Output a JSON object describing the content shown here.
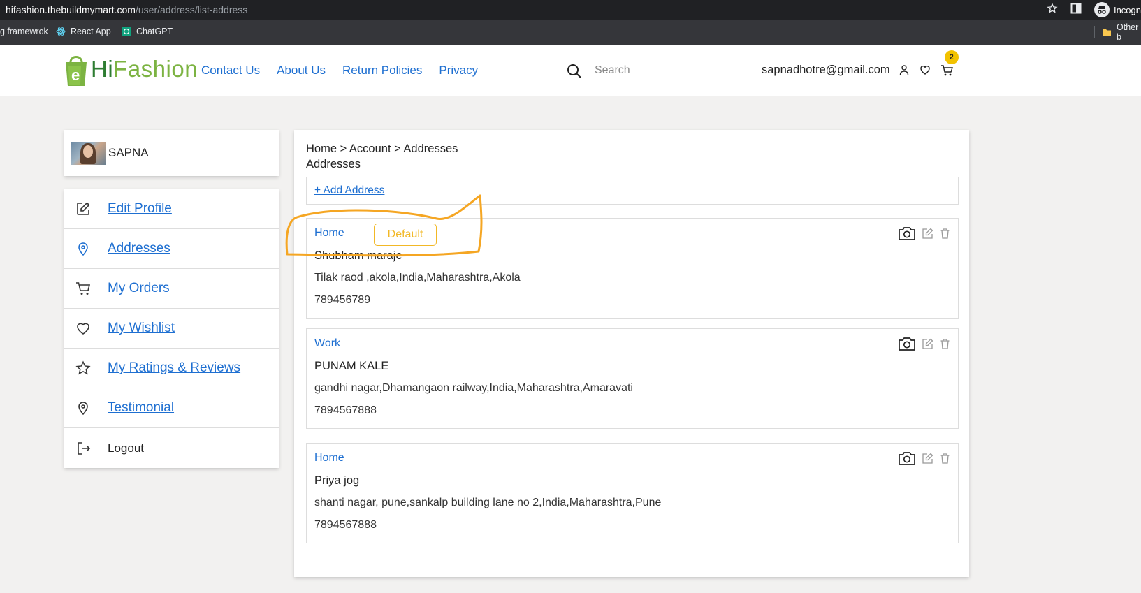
{
  "browser": {
    "url_host": "hifashion.thebuildmymart.com",
    "url_path": "/user/address/list-address",
    "incognito_label": "Incogn",
    "bookmarks": [
      "g framewrok",
      "React App",
      "ChatGPT"
    ],
    "other_bookmarks": "Other b"
  },
  "header": {
    "logo_part1": "Hi",
    "logo_part2": "Fashion",
    "nav": [
      "Contact Us",
      "About Us",
      "Return Policies",
      "Privacy"
    ],
    "search_placeholder": "Search",
    "email": "sapnadhotre@gmail.com",
    "cart_count": "2",
    "colors": {
      "link": "#1e6fd1",
      "badge": "#f2c200",
      "logo_dark": "#2e7d32",
      "logo_light": "#7cb342"
    }
  },
  "sidebar": {
    "user_name": "SAPNA",
    "items": [
      {
        "label": "Edit Profile",
        "icon": "edit-icon"
      },
      {
        "label": "Addresses",
        "icon": "location-icon"
      },
      {
        "label": "My Orders",
        "icon": "cart-icon"
      },
      {
        "label": "My Wishlist",
        "icon": "heart-icon"
      },
      {
        "label": "My Ratings & Reviews",
        "icon": "star-icon"
      },
      {
        "label": "Testimonial",
        "icon": "location-pin-icon"
      },
      {
        "label": "Logout",
        "icon": "logout-icon"
      }
    ]
  },
  "main": {
    "breadcrumb": "Home > Account > Addresses",
    "title": "Addresses",
    "add_address_label": "+ Add Address",
    "default_label": "Default",
    "addresses": [
      {
        "type": "Home",
        "name": "Shubham maraje",
        "line": "Tilak raod ,akola,India,Maharashtra,Akola",
        "phone": "789456789",
        "is_default": true
      },
      {
        "type": "Work",
        "name": "PUNAM KALE",
        "line": "gandhi nagar,Dhamangaon railway,India,Maharashtra,Amaravati",
        "phone": "7894567888",
        "is_default": false
      },
      {
        "type": "Home",
        "name": "Priya jog",
        "line": "shanti nagar, pune,sankalp building lane no 2,India,Maharashtra,Pune",
        "phone": "7894567888",
        "is_default": false
      }
    ]
  }
}
